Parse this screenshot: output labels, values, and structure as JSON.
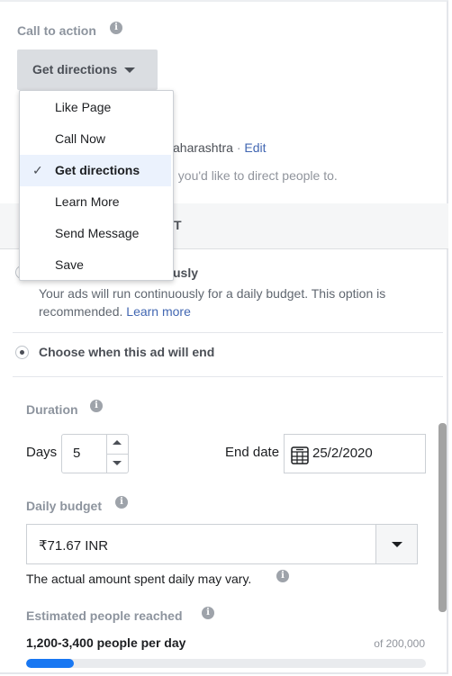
{
  "call_to_action": {
    "label": "Call to action",
    "selected": "Get directions",
    "options": [
      {
        "label": "Like Page"
      },
      {
        "label": "Call Now"
      },
      {
        "label": "Get directions",
        "checked": true
      },
      {
        "label": "Learn More"
      },
      {
        "label": "Send Message"
      },
      {
        "label": "Save"
      }
    ]
  },
  "location": {
    "text_partial": "aharashtra",
    "separator": "·",
    "edit_label": "Edit",
    "hint_partial": "; you'd like to direct people to."
  },
  "section_header_partial": "T",
  "schedule": {
    "option1_partial": "usly",
    "option1_desc": "Your ads will run continuously for a daily budget. This option is recommended.",
    "option1_link": "Learn more",
    "option2_label": "Choose when this ad will end",
    "option2_selected": true
  },
  "duration": {
    "label": "Duration",
    "days_label": "Days",
    "days_value": "5",
    "end_date_label": "End date",
    "end_date_value": "25/2/2020"
  },
  "budget": {
    "label": "Daily budget",
    "value": "₹71.67 INR",
    "note": "The actual amount spent daily may vary."
  },
  "reach": {
    "label": "Estimated people reached",
    "value": "1,200-3,400 people per day",
    "of_total": "of 200,000",
    "progress_percent": 12
  },
  "colors": {
    "accent": "#1877f2",
    "link": "#4267b2",
    "highlight": "#ebf2fd"
  }
}
